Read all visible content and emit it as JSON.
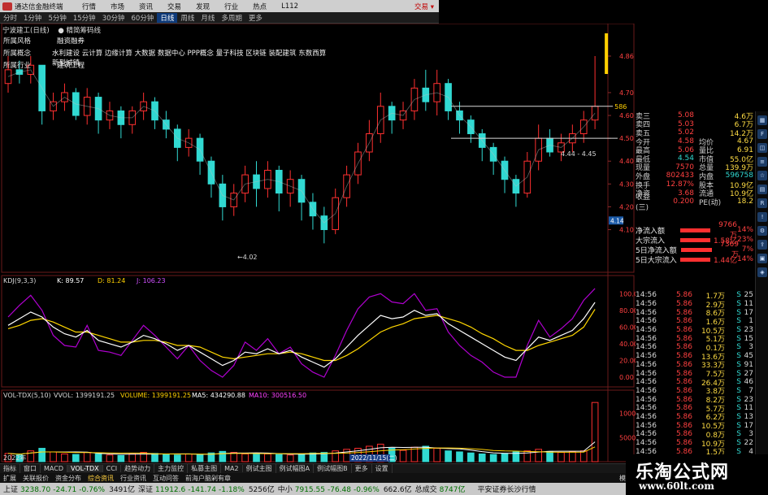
{
  "menubar": {
    "app_title": "通达信金融终端",
    "items": [
      "行情",
      "市场",
      "资讯",
      "交易",
      "发现",
      "行业",
      "热点",
      "L112"
    ],
    "trade_link": "交易 ▾"
  },
  "periodbar": {
    "periods": [
      "分时",
      "1分钟",
      "5分钟",
      "15分钟",
      "30分钟",
      "60分钟",
      "日线",
      "周线",
      "月线",
      "多周期",
      "更多"
    ],
    "active": "日线"
  },
  "stock": {
    "name": "宁波建工(日线)",
    "tag": "● 精简筹码线",
    "header_num": "33"
  },
  "info": [
    {
      "key": "所属风格",
      "value": "融资融券"
    },
    {
      "key": "所属概念",
      "value": "水利建设 云计算 边缘计算 大数据 数据中心 PPP概念 量子科技 区块链 装配建筑 东数西算 新型城镇"
    },
    {
      "key": "所属行业",
      "value": "建筑工程"
    }
  ],
  "price_axis": [
    "4.86",
    "4.70",
    "4.60",
    "4.50",
    "4.40",
    "4.30",
    "4.20",
    "4.10"
  ],
  "price_annotations": {
    "low": "4.02",
    "range": "4.44 - 4.45",
    "ref": "4.64",
    "right_marker": "4.14",
    "end_marker": "586"
  },
  "kdj": {
    "label": "KDJ(9,3,3)",
    "k": "K: 89.57",
    "d": "D: 81.24",
    "j": "J: 106.23",
    "axis": [
      "100.00",
      "80.00",
      "60.00",
      "40.00",
      "20.00",
      "0.00"
    ]
  },
  "vol": {
    "label": "VOL-TDX(5,10)",
    "vvol": "VVOL: 1399191.25",
    "volume": "VOLUME: 1399191.25",
    "ma5": "MA5: 434290.88",
    "ma10": "MA10: 300516.50",
    "axis": [
      "10000",
      "5000"
    ],
    "date_label": "2022/11/15(二)",
    "year_label": "2022年"
  },
  "quote": {
    "rows": [
      {
        "k1": "卖三",
        "v1": "5.08",
        "k2": "",
        "v2": "4.6万"
      },
      {
        "k1": "卖四",
        "v1": "5.03",
        "k2": "",
        "v2": "6.7万"
      },
      {
        "k1": "卖五",
        "v1": "5.02",
        "k2": "",
        "v2": "14.2万"
      },
      {
        "k1": "今开",
        "v1": "4.58",
        "k2": "均价",
        "v2": "4.67"
      },
      {
        "k1": "最高",
        "v1": "5.06",
        "k2": "量比",
        "v2": "6.91"
      },
      {
        "k1": "最低",
        "v1": "4.54",
        "k2": "市值",
        "v2": "55.0亿"
      },
      {
        "k1": "现量",
        "v1": "7570",
        "k2": "总量",
        "v2": "139.9万"
      },
      {
        "k1": "外盘",
        "v1": "802433",
        "k2": "内盘",
        "v2": "596758"
      },
      {
        "k1": "换手",
        "v1": "12.87%",
        "k2": "股本",
        "v2": "10.9亿"
      },
      {
        "k1": "净资",
        "v1": "3.68",
        "k2": "流通",
        "v2": "10.9亿"
      },
      {
        "k1": "收益(三)",
        "v1": "0.200",
        "k2": "PE(动)",
        "v2": "18.2"
      }
    ]
  },
  "flow": [
    {
      "label": "净流入额",
      "value": "9766万",
      "pct": "14%"
    },
    {
      "label": "大宗流入",
      "value": "1.58亿",
      "pct": "23%"
    },
    {
      "label": "5日净流入额",
      "value": "7369万",
      "pct": "7%"
    },
    {
      "label": "5日大宗流入",
      "value": "1.44亿",
      "pct": "14%"
    }
  ],
  "ticks": [
    {
      "t": "14:56",
      "p": "5.86",
      "v": "1.7万",
      "s": "S",
      "n": "25"
    },
    {
      "t": "14:56",
      "p": "5.86",
      "v": "2.9万",
      "s": "S",
      "n": "11"
    },
    {
      "t": "14:56",
      "p": "5.86",
      "v": "8.6万",
      "s": "S",
      "n": "17"
    },
    {
      "t": "14:56",
      "p": "5.86",
      "v": "1.6万",
      "s": "S",
      "n": "1"
    },
    {
      "t": "14:56",
      "p": "5.86",
      "v": "10.5万",
      "s": "S",
      "n": "23"
    },
    {
      "t": "14:56",
      "p": "5.86",
      "v": "5.1万",
      "s": "S",
      "n": "15"
    },
    {
      "t": "14:56",
      "p": "5.86",
      "v": "0.1万",
      "s": "S",
      "n": "3"
    },
    {
      "t": "14:56",
      "p": "5.86",
      "v": "13.6万",
      "s": "S",
      "n": "45"
    },
    {
      "t": "14:56",
      "p": "5.86",
      "v": "33.3万",
      "s": "S",
      "n": "91"
    },
    {
      "t": "14:56",
      "p": "5.86",
      "v": "7.5万",
      "s": "S",
      "n": "27"
    },
    {
      "t": "14:56",
      "p": "5.86",
      "v": "26.4万",
      "s": "S",
      "n": "46"
    },
    {
      "t": "14:56",
      "p": "5.86",
      "v": "3.8万",
      "s": "S",
      "n": "7"
    },
    {
      "t": "14:56",
      "p": "5.86",
      "v": "8.2万",
      "s": "S",
      "n": "23"
    },
    {
      "t": "14:56",
      "p": "5.86",
      "v": "5.7万",
      "s": "S",
      "n": "11"
    },
    {
      "t": "14:56",
      "p": "5.86",
      "v": "6.2万",
      "s": "S",
      "n": "13"
    },
    {
      "t": "14:56",
      "p": "5.86",
      "v": "10.5万",
      "s": "S",
      "n": "17"
    },
    {
      "t": "14:56",
      "p": "5.86",
      "v": "0.8万",
      "s": "S",
      "n": "3"
    },
    {
      "t": "14:56",
      "p": "5.86",
      "v": "10.9万",
      "s": "S",
      "n": "22"
    },
    {
      "t": "14:56",
      "p": "5.86",
      "v": "1.5万",
      "s": "S",
      "n": "4"
    }
  ],
  "tabbar": [
    "指标",
    "窗口",
    "MACD",
    "VOL-TDX",
    "CCI",
    "趋势动力",
    "主力监控",
    "私募主图",
    "MA2",
    "例试主图",
    "例试幅图A",
    "例试幅图B",
    "更多",
    "设置"
  ],
  "tabbar_active": "VOL-TDX",
  "tabbar2": [
    "扩展",
    "关联报价",
    "资金分布",
    "综合资讯",
    "行业资讯",
    "互动问答",
    "前海户脑剁有章"
  ],
  "tabbar2_selected": "综合资讯",
  "tabbar_right": "模板",
  "ticker": [
    {
      "name": "上证",
      "value": "3238.70",
      "chg": "-24.71",
      "pct": "-0.76%",
      "amt": "3491亿",
      "dir": "dn"
    },
    {
      "name": "深证",
      "value": "11912.6",
      "chg": "-141.74",
      "pct": "-1.18%",
      "amt": "5256亿",
      "dir": "dn"
    },
    {
      "name": "中小",
      "value": "7915.55",
      "chg": "-76.48",
      "pct": "-0.96%",
      "amt": "662.6亿",
      "dir": "dn"
    },
    {
      "name": "总成交",
      "value": "8747亿",
      "chg": "",
      "pct": "",
      "amt": "",
      "dir": "dn"
    }
  ],
  "ticker_tail": "平安证券长沙行情",
  "watermark": {
    "title": "乐淘公式网",
    "url": "www.60lt.com"
  },
  "colors": {
    "up": "#ff3030",
    "down": "#31d9d2",
    "kline_k": "#ffffff",
    "kline_d": "#ffd700",
    "kline_j": "#b000d0",
    "ma": "#c0c0c0"
  },
  "chart_data": {
    "type": "table",
    "price_ylim": [
      4.02,
      4.86
    ],
    "candles": [
      {
        "o": 4.74,
        "c": 4.8,
        "h": 4.86,
        "l": 4.7
      },
      {
        "o": 4.8,
        "c": 4.78,
        "h": 4.84,
        "l": 4.74
      },
      {
        "o": 4.78,
        "c": 4.82,
        "h": 4.86,
        "l": 4.74
      },
      {
        "o": 4.82,
        "c": 4.62,
        "h": 4.82,
        "l": 4.56
      },
      {
        "o": 4.62,
        "c": 4.66,
        "h": 4.7,
        "l": 4.58
      },
      {
        "o": 4.66,
        "c": 4.7,
        "h": 4.74,
        "l": 4.62
      },
      {
        "o": 4.7,
        "c": 4.6,
        "h": 4.72,
        "l": 4.58
      },
      {
        "o": 4.6,
        "c": 4.68,
        "h": 4.72,
        "l": 4.56
      },
      {
        "o": 4.68,
        "c": 4.58,
        "h": 4.7,
        "l": 4.52
      },
      {
        "o": 4.58,
        "c": 4.62,
        "h": 4.66,
        "l": 4.54
      },
      {
        "o": 4.62,
        "c": 4.56,
        "h": 4.64,
        "l": 4.5
      },
      {
        "o": 4.56,
        "c": 4.62,
        "h": 4.64,
        "l": 4.52
      },
      {
        "o": 4.62,
        "c": 4.66,
        "h": 4.7,
        "l": 4.58
      },
      {
        "o": 4.66,
        "c": 4.58,
        "h": 4.68,
        "l": 4.54
      },
      {
        "o": 4.58,
        "c": 4.54,
        "h": 4.62,
        "l": 4.5
      },
      {
        "o": 4.54,
        "c": 4.46,
        "h": 4.56,
        "l": 4.4
      },
      {
        "o": 4.46,
        "c": 4.5,
        "h": 4.54,
        "l": 4.42
      },
      {
        "o": 4.5,
        "c": 4.4,
        "h": 4.52,
        "l": 4.34
      },
      {
        "o": 4.4,
        "c": 4.3,
        "h": 4.42,
        "l": 4.24
      },
      {
        "o": 4.3,
        "c": 4.2,
        "h": 4.34,
        "l": 4.14
      },
      {
        "o": 4.2,
        "c": 4.26,
        "h": 4.3,
        "l": 4.16
      },
      {
        "o": 4.26,
        "c": 4.34,
        "h": 4.38,
        "l": 4.22
      },
      {
        "o": 4.34,
        "c": 4.28,
        "h": 4.4,
        "l": 4.2
      },
      {
        "o": 4.28,
        "c": 4.36,
        "h": 4.4,
        "l": 4.24
      },
      {
        "o": 4.36,
        "c": 4.26,
        "h": 4.38,
        "l": 4.18
      },
      {
        "o": 4.26,
        "c": 4.32,
        "h": 4.36,
        "l": 4.2
      },
      {
        "o": 4.32,
        "c": 4.22,
        "h": 4.34,
        "l": 4.14
      },
      {
        "o": 4.22,
        "c": 4.16,
        "h": 4.26,
        "l": 4.1
      },
      {
        "o": 4.16,
        "c": 4.1,
        "h": 4.2,
        "l": 4.04
      },
      {
        "o": 4.1,
        "c": 4.24,
        "h": 4.28,
        "l": 4.08
      },
      {
        "o": 4.24,
        "c": 4.34,
        "h": 4.38,
        "l": 4.2
      },
      {
        "o": 4.34,
        "c": 4.44,
        "h": 4.48,
        "l": 4.3
      },
      {
        "o": 4.44,
        "c": 4.52,
        "h": 4.58,
        "l": 4.4
      },
      {
        "o": 4.52,
        "c": 4.64,
        "h": 4.7,
        "l": 4.48
      },
      {
        "o": 4.64,
        "c": 4.58,
        "h": 4.66,
        "l": 4.52
      },
      {
        "o": 4.58,
        "c": 4.62,
        "h": 4.66,
        "l": 4.54
      },
      {
        "o": 4.62,
        "c": 4.72,
        "h": 4.76,
        "l": 4.58
      },
      {
        "o": 4.72,
        "c": 4.66,
        "h": 4.8,
        "l": 4.62
      },
      {
        "o": 4.66,
        "c": 4.74,
        "h": 4.8,
        "l": 4.6
      },
      {
        "o": 4.74,
        "c": 4.62,
        "h": 4.76,
        "l": 4.58
      },
      {
        "o": 4.62,
        "c": 4.58,
        "h": 4.66,
        "l": 4.52
      },
      {
        "o": 4.58,
        "c": 4.52,
        "h": 4.6,
        "l": 4.48
      },
      {
        "o": 4.52,
        "c": 4.46,
        "h": 4.54,
        "l": 4.4
      },
      {
        "o": 4.46,
        "c": 4.4,
        "h": 4.48,
        "l": 4.34
      },
      {
        "o": 4.4,
        "c": 4.32,
        "h": 4.42,
        "l": 4.26
      },
      {
        "o": 4.32,
        "c": 4.26,
        "h": 4.34,
        "l": 4.2
      },
      {
        "o": 4.26,
        "c": 4.4,
        "h": 4.44,
        "l": 4.24
      },
      {
        "o": 4.4,
        "c": 4.5,
        "h": 4.56,
        "l": 4.36
      },
      {
        "o": 4.5,
        "c": 4.44,
        "h": 4.54,
        "l": 4.42
      },
      {
        "o": 4.44,
        "c": 4.48,
        "h": 4.52,
        "l": 4.4
      },
      {
        "o": 4.48,
        "c": 4.52,
        "h": 4.56,
        "l": 4.44
      },
      {
        "o": 4.52,
        "c": 4.58,
        "h": 4.62,
        "l": 4.48
      },
      {
        "o": 4.58,
        "c": 4.64,
        "h": 4.86,
        "l": 4.54
      }
    ],
    "kdj_k": [
      62,
      70,
      78,
      72,
      60,
      52,
      48,
      56,
      44,
      40,
      36,
      42,
      50,
      46,
      40,
      32,
      38,
      30,
      22,
      14,
      20,
      30,
      28,
      34,
      28,
      32,
      24,
      18,
      12,
      22,
      36,
      50,
      62,
      74,
      70,
      72,
      80,
      74,
      76,
      64,
      56,
      48,
      40,
      32,
      24,
      20,
      34,
      48,
      44,
      50,
      56,
      70,
      89.57
    ],
    "kdj_d": [
      58,
      62,
      68,
      70,
      66,
      60,
      54,
      54,
      50,
      46,
      42,
      42,
      44,
      44,
      42,
      38,
      38,
      36,
      30,
      24,
      22,
      24,
      26,
      28,
      28,
      30,
      28,
      24,
      20,
      20,
      26,
      34,
      44,
      54,
      60,
      64,
      70,
      72,
      74,
      70,
      66,
      60,
      52,
      46,
      38,
      32,
      32,
      38,
      42,
      46,
      50,
      60,
      81.24
    ],
    "kdj_j": [
      72,
      86,
      98,
      80,
      50,
      38,
      36,
      62,
      32,
      30,
      26,
      44,
      62,
      50,
      36,
      22,
      38,
      20,
      8,
      0,
      14,
      42,
      32,
      46,
      28,
      36,
      16,
      6,
      0,
      26,
      56,
      82,
      96,
      100,
      90,
      88,
      100,
      80,
      82,
      54,
      38,
      26,
      18,
      6,
      0,
      0,
      38,
      68,
      48,
      58,
      70,
      92,
      106.23
    ],
    "volume": [
      320,
      260,
      420,
      520,
      380,
      300,
      280,
      360,
      300,
      260,
      240,
      300,
      360,
      320,
      280,
      260,
      300,
      280,
      340,
      400,
      360,
      300,
      320,
      300,
      280,
      260,
      300,
      340,
      360,
      420,
      480,
      520,
      600,
      680,
      520,
      440,
      560,
      600,
      520,
      420,
      380,
      340,
      300,
      280,
      320,
      380,
      420,
      480,
      400,
      360,
      380,
      420,
      2300
    ]
  }
}
